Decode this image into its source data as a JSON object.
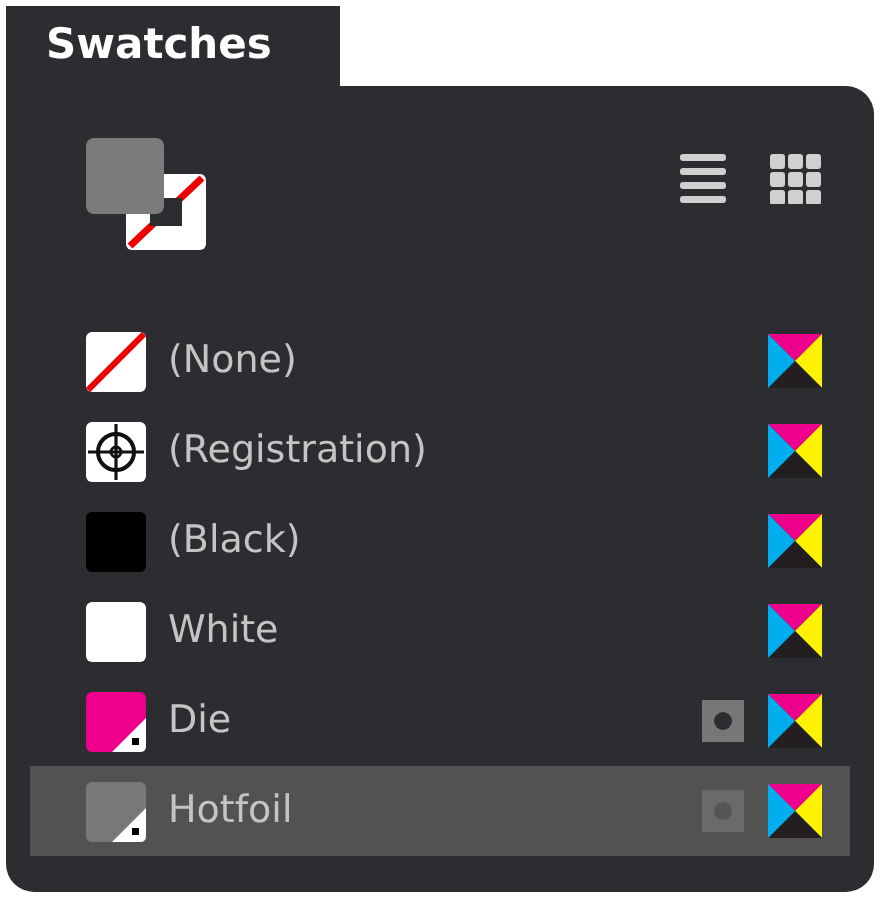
{
  "panel": {
    "title": "Swatches"
  },
  "fill_stroke": [
    {
      "kind": "fill",
      "color": "#7a7b7a"
    },
    {
      "kind": "stroke_none"
    }
  ],
  "swatches": [
    {
      "name": "(None)",
      "kind": "none",
      "spot": false,
      "selected": false
    },
    {
      "name": "(Registration)",
      "kind": "registration",
      "spot": false,
      "selected": false
    },
    {
      "name": "(Black)",
      "kind": "solid",
      "color": "#000000",
      "spot": false,
      "selected": false
    },
    {
      "name": "White",
      "kind": "solid",
      "color": "#ffffff",
      "spot": false,
      "selected": false
    },
    {
      "name": "Die",
      "kind": "spot",
      "color": "#ec008c",
      "spot": true,
      "selected": false
    },
    {
      "name": "Hotfoil",
      "kind": "spot",
      "color": "#777877",
      "spot": true,
      "selected": true
    }
  ]
}
